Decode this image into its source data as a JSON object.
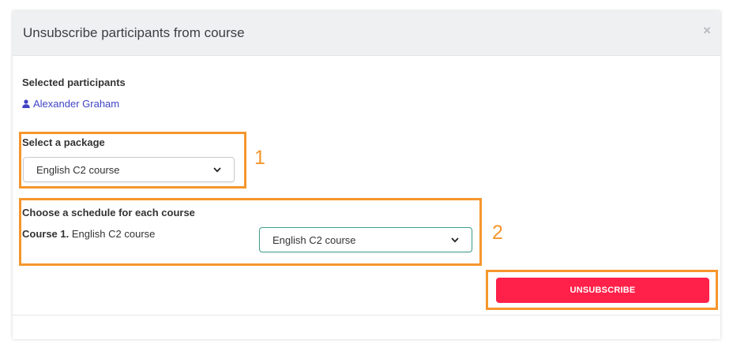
{
  "modal": {
    "title": "Unsubscribe participants from course",
    "close_glyph": "×"
  },
  "participants": {
    "label": "Selected participants",
    "items": [
      {
        "name": "Alexander Graham",
        "icon": "user-icon"
      }
    ]
  },
  "package": {
    "label": "Select a package",
    "selected": "English C2 course"
  },
  "schedule": {
    "label": "Choose a schedule for each course",
    "courses": [
      {
        "prefix": "Course 1.",
        "name": "English C2 course",
        "selected": "English C2 course"
      }
    ]
  },
  "actions": {
    "unsubscribe_label": "UNSUBSCRIBE"
  },
  "annotations": {
    "callout_1": "1",
    "callout_2": "2"
  },
  "colors": {
    "accent_orange": "#f5962c",
    "button_red": "#ff2149",
    "link_blue": "#3f43c4",
    "select_green_border": "#3f9f8c"
  }
}
